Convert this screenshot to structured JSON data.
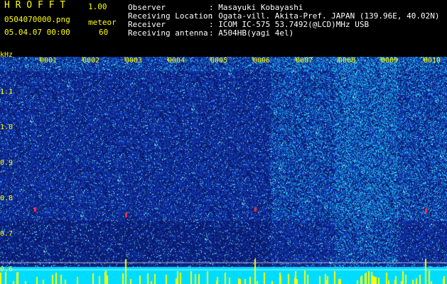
{
  "header": {
    "app_title": "H R O F F T",
    "version": "1.00",
    "filename": "0504070000.png",
    "mode_label": "meteor",
    "datetime": "05.04.07 00:00",
    "count": "60",
    "info": [
      {
        "label": "Observer",
        "value": ": Masayuki Kobayashi"
      },
      {
        "label": "Receiving Location",
        "value": ": Ogata-vill. Akita-Pref. JAPAN (139.96E, 40.02N)"
      },
      {
        "label": "Receiver",
        "value": ": ICOM IC-575 53.7492(@LCD)MHz USB"
      },
      {
        "label": "Receiving antenna",
        "value": ": A504HB(yagi 4el)"
      }
    ]
  },
  "axis": {
    "unit_label": "kHz",
    "y_labels": [
      "1.1",
      "1.0",
      "0.9",
      "0.8",
      "0.7",
      "0.6"
    ],
    "x_labels": [
      "0001",
      "0002",
      "0003",
      "0004",
      "0005",
      "0006",
      "0007",
      "0008",
      "0009",
      "0010"
    ]
  },
  "colors": {
    "text_yellow": "#ffff00",
    "text_white": "#ffffff",
    "background": "#000000",
    "spectrum_base": "#0a1a5a",
    "noise_floor": "#00e0ff",
    "meteor_red": "#ff3030"
  }
}
